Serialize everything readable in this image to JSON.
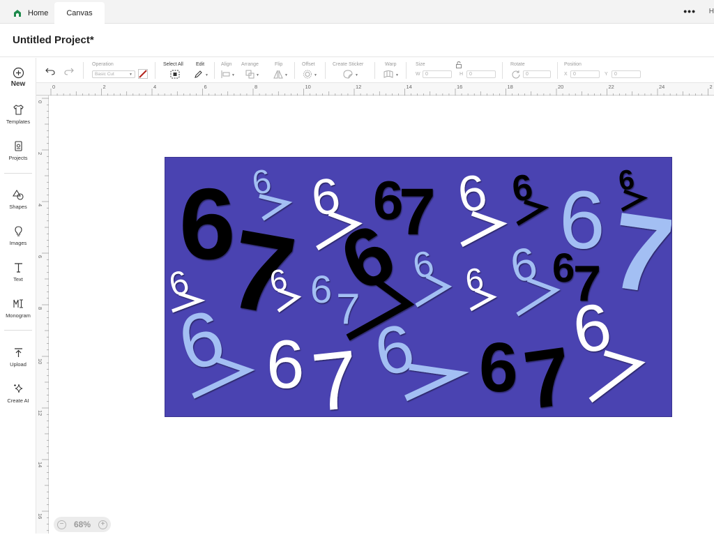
{
  "tabs": {
    "home_label": "Home",
    "canvas_label": "Canvas",
    "more_label": "•••",
    "cut_label": "H"
  },
  "project": {
    "title": "Untitled Project*"
  },
  "sidebar": {
    "new_label": "New",
    "items": [
      {
        "label": "Templates",
        "icon": "shirt-icon"
      },
      {
        "label": "Projects",
        "icon": "projects-icon"
      },
      {
        "label": "Shapes",
        "icon": "shapes-icon"
      },
      {
        "label": "Images",
        "icon": "lightbulb-icon"
      },
      {
        "label": "Text",
        "icon": "text-icon"
      },
      {
        "label": "Monogram",
        "icon": "monogram-icon"
      },
      {
        "label": "Upload",
        "icon": "upload-icon"
      },
      {
        "label": "Create AI",
        "icon": "sparkle-icon"
      }
    ]
  },
  "toolbar": {
    "operation_label": "Operation",
    "operation_value": "Basic Cut",
    "select_all_label": "Select All",
    "edit_label": "Edit",
    "align_label": "Align",
    "arrange_label": "Arrange",
    "flip_label": "Flip",
    "offset_label": "Offset",
    "create_sticker_label": "Create Sticker",
    "warp_label": "Warp",
    "size_label": "Size",
    "w_label": "W",
    "w_value": "0",
    "h_label": "H",
    "h_value": "0",
    "rotate_label": "Rotate",
    "rotate_value": "0",
    "position_label": "Position",
    "x_label": "X",
    "x_value": "0",
    "y_label": "Y",
    "y_value": "0"
  },
  "ruler": {
    "top": [
      "0",
      "2",
      "4",
      "6",
      "8",
      "10",
      "12",
      "14",
      "16",
      "18",
      "20",
      "22",
      "24",
      "2"
    ],
    "left": [
      "0",
      "2",
      "4",
      "6",
      "8",
      "10",
      "12",
      "14",
      "16"
    ]
  },
  "zoom": {
    "value": "68%",
    "minus": "−",
    "plus": "+"
  },
  "design": {
    "background_color": "#4a43b1",
    "colors": {
      "black": "#000000",
      "white": "#ffffff",
      "light_blue": "#a3bff3"
    }
  }
}
